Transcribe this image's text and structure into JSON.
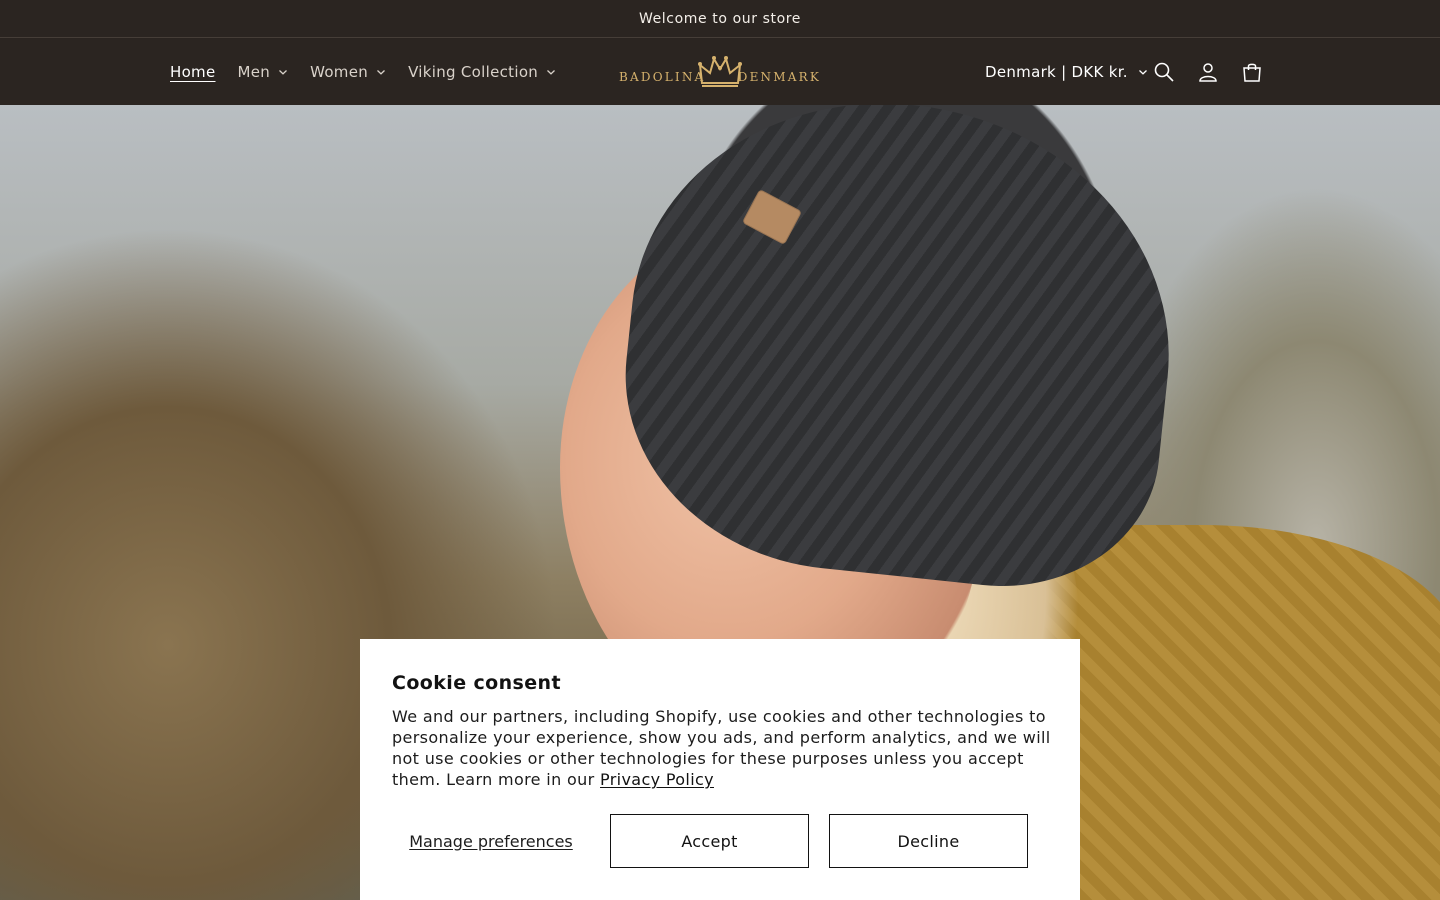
{
  "announcement": {
    "text": "Welcome to our store"
  },
  "nav": {
    "items": [
      {
        "label": "Home",
        "active": true,
        "has_dropdown": false
      },
      {
        "label": "Men",
        "active": false,
        "has_dropdown": true
      },
      {
        "label": "Women",
        "active": false,
        "has_dropdown": true
      },
      {
        "label": "Viking Collection",
        "active": false,
        "has_dropdown": true
      }
    ]
  },
  "logo": {
    "left_text": "BADOLINA",
    "right_text": "DENMARK",
    "icon": "crown-icon",
    "color": "#d6b26d"
  },
  "header_tools": {
    "locale_label": "Denmark | DKK kr.",
    "icons": [
      "search-icon",
      "account-icon",
      "cart-icon"
    ]
  },
  "hero": {
    "image": "woman-in-knit-beanie-photo"
  },
  "cookie": {
    "title": "Cookie consent",
    "body": "We and our partners, including Shopify, use cookies and other technologies to personalize your experience, show you ads, and perform analytics, and we will not use cookies or other technologies for these purposes unless you accept them. Learn more in our ",
    "privacy_link": "Privacy Policy",
    "manage_label": "Manage preferences",
    "accept_label": "Accept",
    "decline_label": "Decline"
  },
  "colors": {
    "header_bg": "#2b2521",
    "accent_gold": "#d6b26d"
  }
}
